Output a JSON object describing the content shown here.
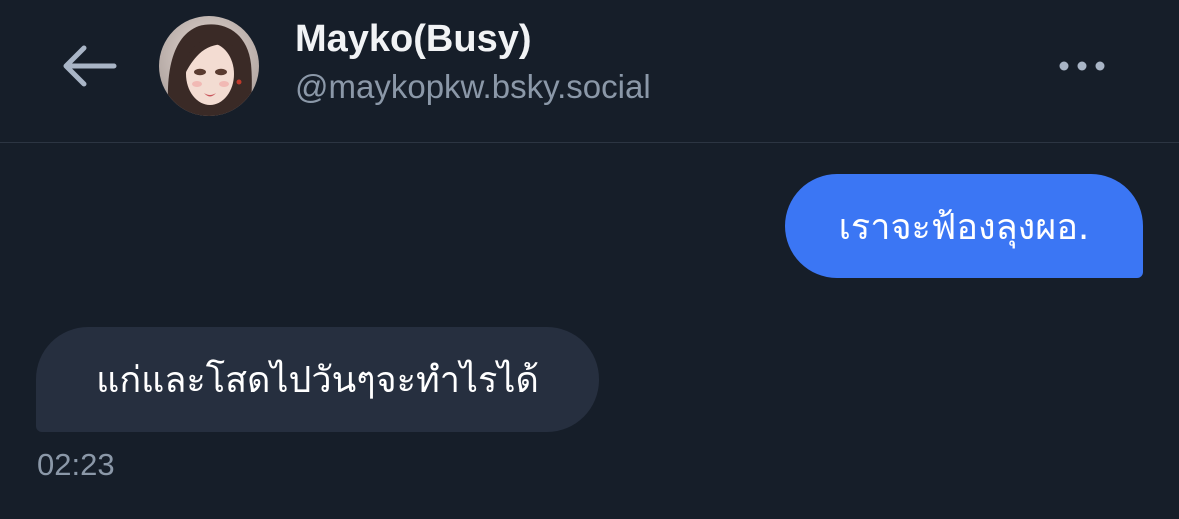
{
  "header": {
    "display_name": "Mayko(Busy)",
    "handle": "@maykopkw.bsky.social",
    "back_icon": "arrow-left-icon",
    "more_icon": "ellipsis-icon"
  },
  "messages": [
    {
      "direction": "outgoing",
      "text": "เราจะฟ้องลุงผอ."
    },
    {
      "direction": "incoming",
      "text": "แก่และโสดไปวันๆจะทำไรได้"
    }
  ],
  "last_timestamp": "02:23",
  "colors": {
    "background": "#161e29",
    "outgoing_bubble": "#3b76f4",
    "incoming_bubble": "#262f3f",
    "muted_text": "#8b98a8"
  }
}
